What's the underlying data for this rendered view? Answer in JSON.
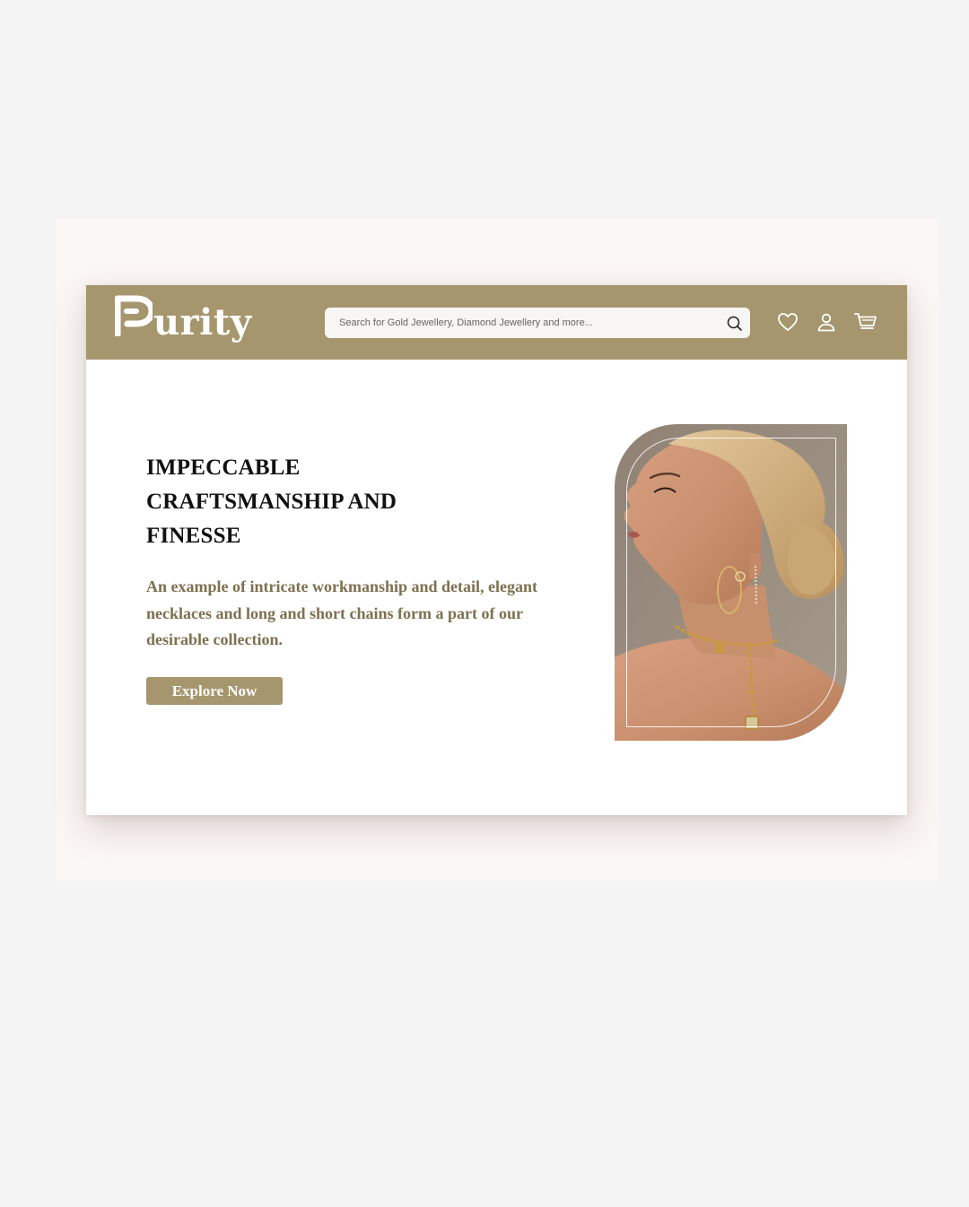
{
  "brand": {
    "name": "urity",
    "mark_letter": "P"
  },
  "header": {
    "search_placeholder": "Search for Gold Jewellery, Diamond Jewellery and more...",
    "icons": [
      "search-icon",
      "heart-icon",
      "user-icon",
      "cart-icon"
    ]
  },
  "hero": {
    "title_lines": [
      "IMPECCABLE",
      "CRAFTSMANSHIP AND",
      "FINESSE"
    ],
    "description_lines": [
      "An example of intricate workmanship and detail, elegant",
      "necklaces and long and short chains form a part of our",
      "desirable collection."
    ],
    "cta_label": "Explore Now"
  },
  "colors": {
    "page_bg": "#f4f4f4",
    "backdrop": "#fbf7f6",
    "brand_gold": "#a5966e",
    "text_dark": "#111111",
    "text_gold": "#7d704f",
    "white": "#ffffff"
  }
}
